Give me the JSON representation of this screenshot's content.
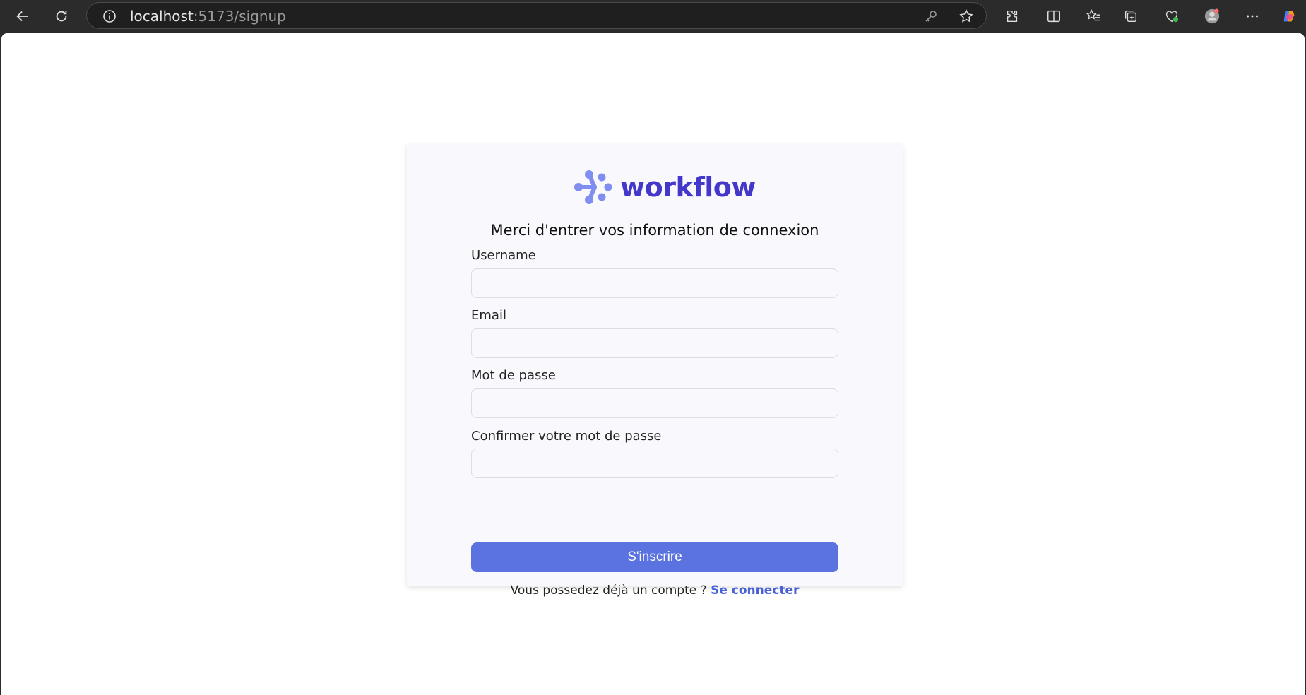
{
  "browser": {
    "url_host": "localhost",
    "url_path": ":5173/signup"
  },
  "brand": {
    "name": "workflow",
    "color": "#4338ca",
    "logo_color": "#7f8ef0"
  },
  "form": {
    "subtitle": "Merci d'entrer vos information de connexion",
    "fields": [
      {
        "label": "Username",
        "value": ""
      },
      {
        "label": "Email",
        "value": ""
      },
      {
        "label": "Mot de passe",
        "value": ""
      },
      {
        "label": "Confirmer votre mot de passe",
        "value": ""
      }
    ],
    "submit_label": "S'inscrire",
    "submit_color": "#5b73e0",
    "footer_text": "Vous possedez déjà un compte ? ",
    "footer_link": "Se connecter"
  }
}
